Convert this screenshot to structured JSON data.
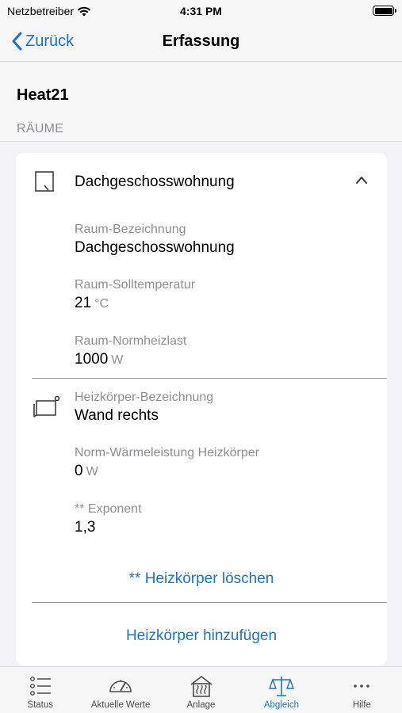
{
  "status_bar": {
    "carrier": "Netzbetreiber",
    "time": "4:31 PM"
  },
  "nav": {
    "back_label": "Zurück",
    "title": "Erfassung"
  },
  "app_name": "Heat21",
  "section_label": "RÄUME",
  "room": {
    "title": "Dachgeschosswohnung",
    "fields": {
      "name": {
        "label": "Raum-Bezeichnung",
        "value": "Dachgeschosswohnung"
      },
      "temp": {
        "label": "Raum-Solltemperatur",
        "value": "21",
        "unit": "°C"
      },
      "load": {
        "label": "Raum-Normheizlast",
        "value": "1000",
        "unit": "W"
      }
    }
  },
  "radiator": {
    "name": {
      "label": "Heizkörper-Bezeichnung",
      "value": "Wand rechts"
    },
    "power": {
      "label": "Norm-Wärmeleistung Heizkörper",
      "value": "0",
      "unit": "W"
    },
    "exponent": {
      "label": "** Exponent",
      "value": "1,3"
    },
    "delete_label": "** Heizkörper löschen"
  },
  "add_radiator_label": "Heizkörper hinzufügen",
  "tabs": [
    {
      "label": "Status",
      "icon": "list-icon"
    },
    {
      "label": "Aktuelle Werte",
      "icon": "gauge-icon"
    },
    {
      "label": "Anlage",
      "icon": "house-heat-icon"
    },
    {
      "label": "Abgleich",
      "icon": "scale-icon"
    },
    {
      "label": "Hilfe",
      "icon": "ellipsis-icon"
    }
  ],
  "colors": {
    "accent": "#1a73c8",
    "secondary_text": "#8e8e93",
    "background": "#f2f2f7"
  }
}
